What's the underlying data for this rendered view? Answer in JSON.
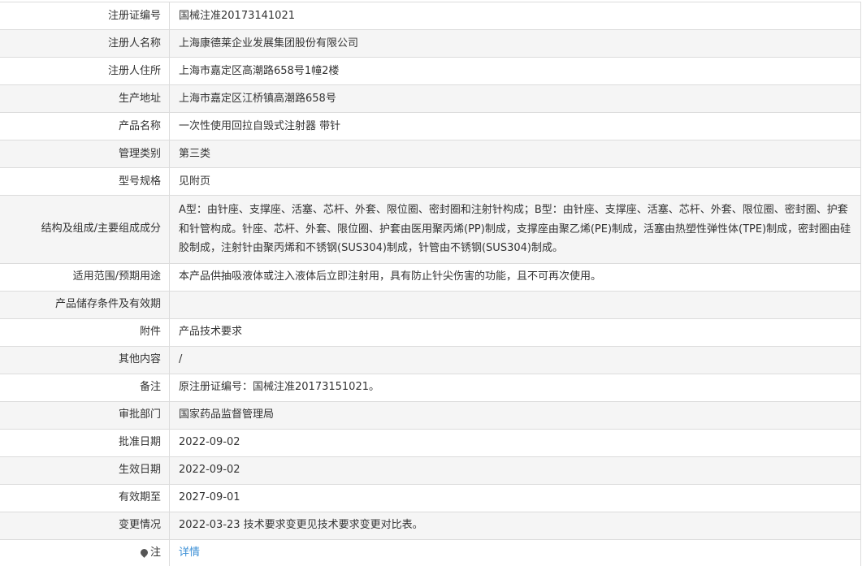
{
  "rows": [
    {
      "label": "注册证编号",
      "value": "国械注准20173141021"
    },
    {
      "label": "注册人名称",
      "value": "上海康德莱企业发展集团股份有限公司"
    },
    {
      "label": "注册人住所",
      "value": "上海市嘉定区高潮路658号1幢2楼"
    },
    {
      "label": "生产地址",
      "value": "上海市嘉定区江桥镇高潮路658号"
    },
    {
      "label": "产品名称",
      "value": "一次性使用回拉自毁式注射器 带针"
    },
    {
      "label": "管理类别",
      "value": "第三类"
    },
    {
      "label": "型号规格",
      "value": "见附页"
    },
    {
      "label": "结构及组成/主要组成成分",
      "value": "A型：由针座、支撑座、活塞、芯杆、外套、限位圈、密封圈和注射针构成；B型：由针座、支撑座、活塞、芯杆、外套、限位圈、密封圈、护套和针管构成。针座、芯杆、外套、限位圈、护套由医用聚丙烯(PP)制成，支撑座由聚乙烯(PE)制成，活塞由热塑性弹性体(TPE)制成，密封圈由硅胶制成，注射针由聚丙烯和不锈钢(SUS304)制成，针管由不锈钢(SUS304)制成。"
    },
    {
      "label": "适用范围/预期用途",
      "value": "本产品供抽吸液体或注入液体后立即注射用，具有防止针尖伤害的功能，且不可再次使用。"
    },
    {
      "label": "产品储存条件及有效期",
      "value": ""
    },
    {
      "label": "附件",
      "value": "产品技术要求"
    },
    {
      "label": "其他内容",
      "value": "/"
    },
    {
      "label": "备注",
      "value": "原注册证编号：国械注准20173151021。"
    },
    {
      "label": "审批部门",
      "value": "国家药品监督管理局"
    },
    {
      "label": "批准日期",
      "value": "2022-09-02"
    },
    {
      "label": "生效日期",
      "value": "2022-09-02"
    },
    {
      "label": "有效期至",
      "value": "2027-09-01"
    },
    {
      "label": "变更情况",
      "value": "2022-03-23 技术要求变更见技术要求变更对比表。"
    }
  ],
  "note": {
    "icon": "pin-icon",
    "label": "注",
    "link_text": "详情",
    "link_color": "#3b8fd6"
  }
}
